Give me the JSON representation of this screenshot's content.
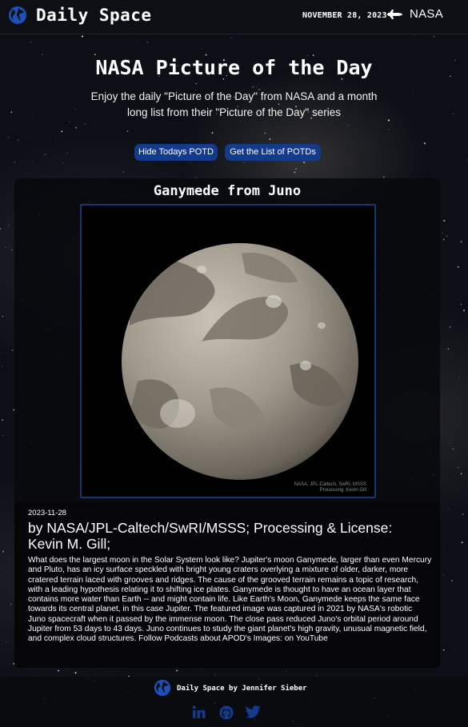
{
  "header": {
    "brand": "Daily Space",
    "date": "NOVEMBER 28, 2023",
    "nasa_label": "NASA",
    "brand_icon": "globe-icon",
    "nasa_icon": "shuttle-icon"
  },
  "hero": {
    "title": "NASA Picture of the Day",
    "subtitle": "Enjoy the daily \"Picture of the Day\" from NASA and a month long list from their \"Picture of the Day\" series"
  },
  "actions": {
    "hide_label": "Hide Todays POTD",
    "list_label": "Get the List of POTDs"
  },
  "potd": {
    "title": "Ganymede from Juno",
    "image_credit_line1": "NASA, JPL-Caltech, SwRI, MSSS",
    "image_credit_line2": "Processing: Kevin Gill",
    "date": "2023-11-28",
    "credit": "by NASA/JPL-Caltech/SwRI/MSSS; Processing & License: Kevin M. Gill;",
    "explanation": "What does the largest moon in the Solar System look like? Jupiter's moon Ganymede, larger than even Mercury and Pluto, has an icy surface speckled with bright young craters overlying a mixture of older, darker, more cratered terrain laced with grooves and ridges. The cause of the grooved terrain remains a topic of research, with a leading hypothesis relating it to shifting ice plates. Ganymede is thought to have an ocean layer that contains more water than Earth -- and might contain life. Like Earth's Moon, Ganymede keeps the same face towards its central planet, in this case Jupiter. The featured image was captured in 2021 by NASA's robotic Juno spacecraft when it passed by the immense moon. The close pass reduced Juno's orbital period around Jupiter from 53 days to 43 days. Juno continues to study the giant planet's high gravity, unusual magnetic field, and complex cloud structures. Follow Podcasts about APOD's Images: on YouTube"
  },
  "footer": {
    "text": "Daily Space by Jennifer Sieber",
    "icons": [
      "linkedin-icon",
      "github-icon",
      "twitter-icon"
    ],
    "icon_color": "#143a8c"
  },
  "colors": {
    "accent": "#143a8c",
    "header_bg": "#0d0f14"
  }
}
